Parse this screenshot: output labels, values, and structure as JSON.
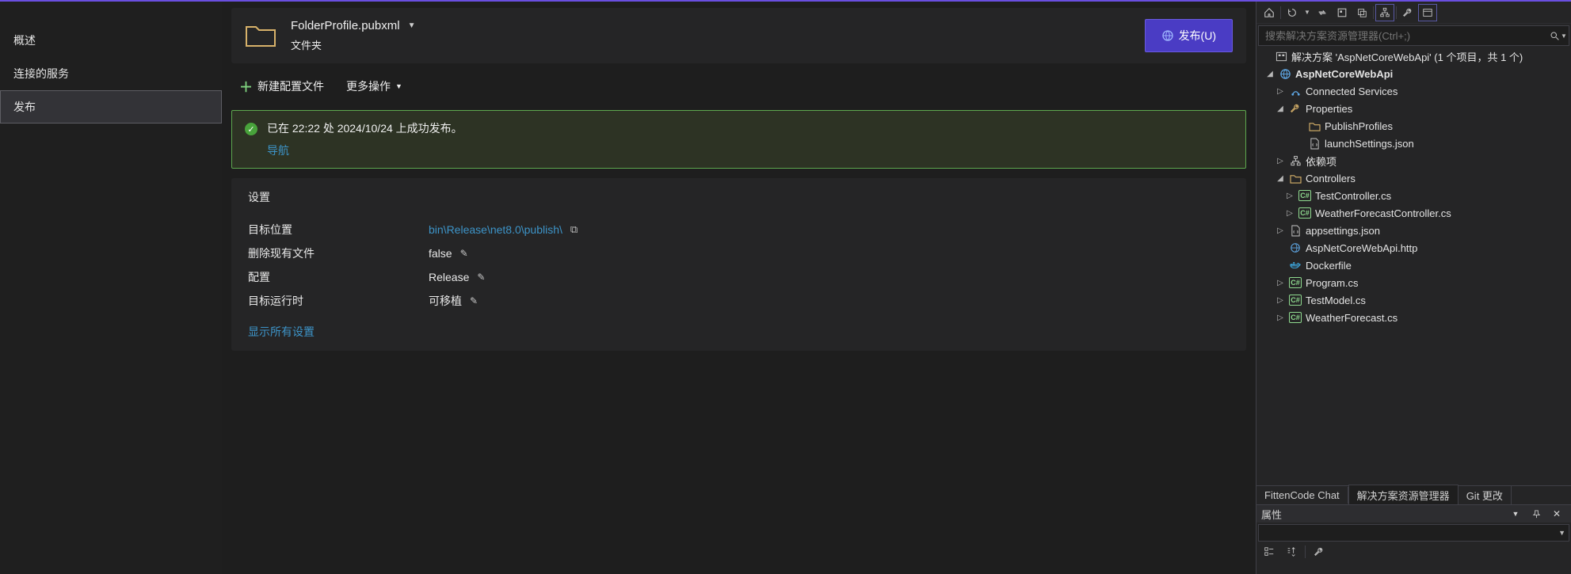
{
  "left_nav": {
    "items": [
      {
        "label": "概述"
      },
      {
        "label": "连接的服务"
      },
      {
        "label": "发布",
        "selected": true
      }
    ]
  },
  "header": {
    "profile_name": "FolderProfile.pubxml",
    "subtitle": "文件夹",
    "publish_button": "发布(U)"
  },
  "actions": {
    "new_profile": "新建配置文件",
    "more": "更多操作"
  },
  "success": {
    "message": "已在 22:22 处 2024/10/24 上成功发布。",
    "nav_link": "导航"
  },
  "settings": {
    "title": "设置",
    "rows": [
      {
        "label": "目标位置",
        "value": "bin\\Release\\net8.0\\publish\\",
        "link": true,
        "copy": true
      },
      {
        "label": "删除现有文件",
        "value": "false",
        "edit": true
      },
      {
        "label": "配置",
        "value": "Release",
        "edit": true
      },
      {
        "label": "目标运行时",
        "value": "可移植",
        "edit": true
      }
    ],
    "show_all": "显示所有设置"
  },
  "solution_explorer": {
    "search_placeholder": "搜索解决方案资源管理器(Ctrl+;)",
    "tree": {
      "solution": "解决方案 'AspNetCoreWebApi' (1 个项目，共 1 个)",
      "project": "AspNetCoreWebApi",
      "nodes": {
        "connected_services": "Connected Services",
        "properties": "Properties",
        "publish_profiles": "PublishProfiles",
        "launch_settings": "launchSettings.json",
        "dependencies": "依赖项",
        "controllers": "Controllers",
        "test_controller": "TestController.cs",
        "weather_controller": "WeatherForecastController.cs",
        "appsettings": "appsettings.json",
        "http_file": "AspNetCoreWebApi.http",
        "dockerfile": "Dockerfile",
        "program": "Program.cs",
        "test_model": "TestModel.cs",
        "weather_forecast": "WeatherForecast.cs"
      }
    },
    "bottom_tabs": {
      "tab1": "FittenCode Chat",
      "tab2": "解决方案资源管理器",
      "tab3": "Git 更改"
    }
  },
  "properties_panel": {
    "title": "属性"
  }
}
